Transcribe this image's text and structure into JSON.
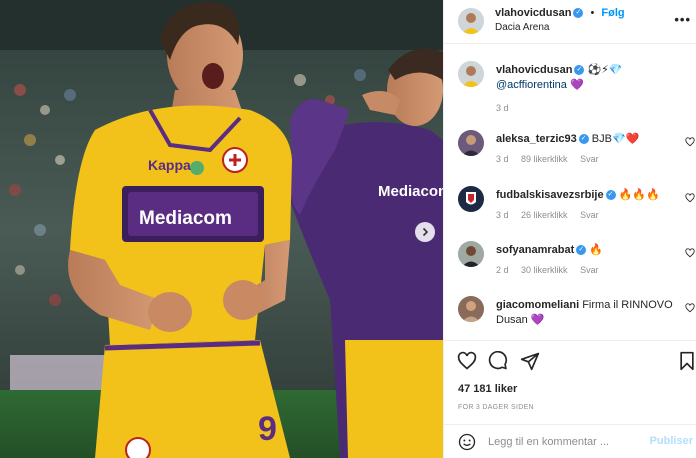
{
  "header": {
    "username": "vlahovicdusan",
    "separator": "•",
    "follow_label": "Følg",
    "location": "Dacia Arena",
    "more_label": "•••"
  },
  "photo": {
    "sponsor_text": "Mediacom",
    "jersey_number": "9",
    "kit_brand": "Mediacom"
  },
  "caption": {
    "username": "vlahovicdusan",
    "emojis": "⚽️⚡💎",
    "mention": "@acffiorentina",
    "heart": "💜",
    "time": "3 d"
  },
  "comments": [
    {
      "username": "aleksa_terzic93",
      "text": "BJB💎❤️",
      "time": "3 d",
      "likes": "89 likerklikk",
      "reply": "Svar",
      "verified": true
    },
    {
      "username": "fudbalskisavezsrbije",
      "text": "🔥🔥🔥",
      "time": "3 d",
      "likes": "26 likerklikk",
      "reply": "Svar",
      "verified": true
    },
    {
      "username": "sofyanamrabat",
      "text": "🔥",
      "time": "2 d",
      "likes": "30 likerklikk",
      "reply": "Svar",
      "verified": true
    },
    {
      "username": "giacomomeliani",
      "text": "Firma il RINNOVO Dusan 💜",
      "verified": false
    }
  ],
  "footer": {
    "likes": "47 181 liker",
    "posted_ago": "FOR 3 DAGER SIDEN",
    "comment_placeholder": "Legg til en kommentar ...",
    "post_label": "Publiser"
  },
  "colors": {
    "accent": "#0095f6",
    "verified": "#3897f0",
    "jersey_yellow": "#f2c21a",
    "jersey_purple": "#5a2d82"
  },
  "icons": [
    "heart-icon",
    "comment-icon",
    "share-icon",
    "bookmark-icon",
    "emoji-icon",
    "verified-badge-icon",
    "chevron-right-icon"
  ]
}
